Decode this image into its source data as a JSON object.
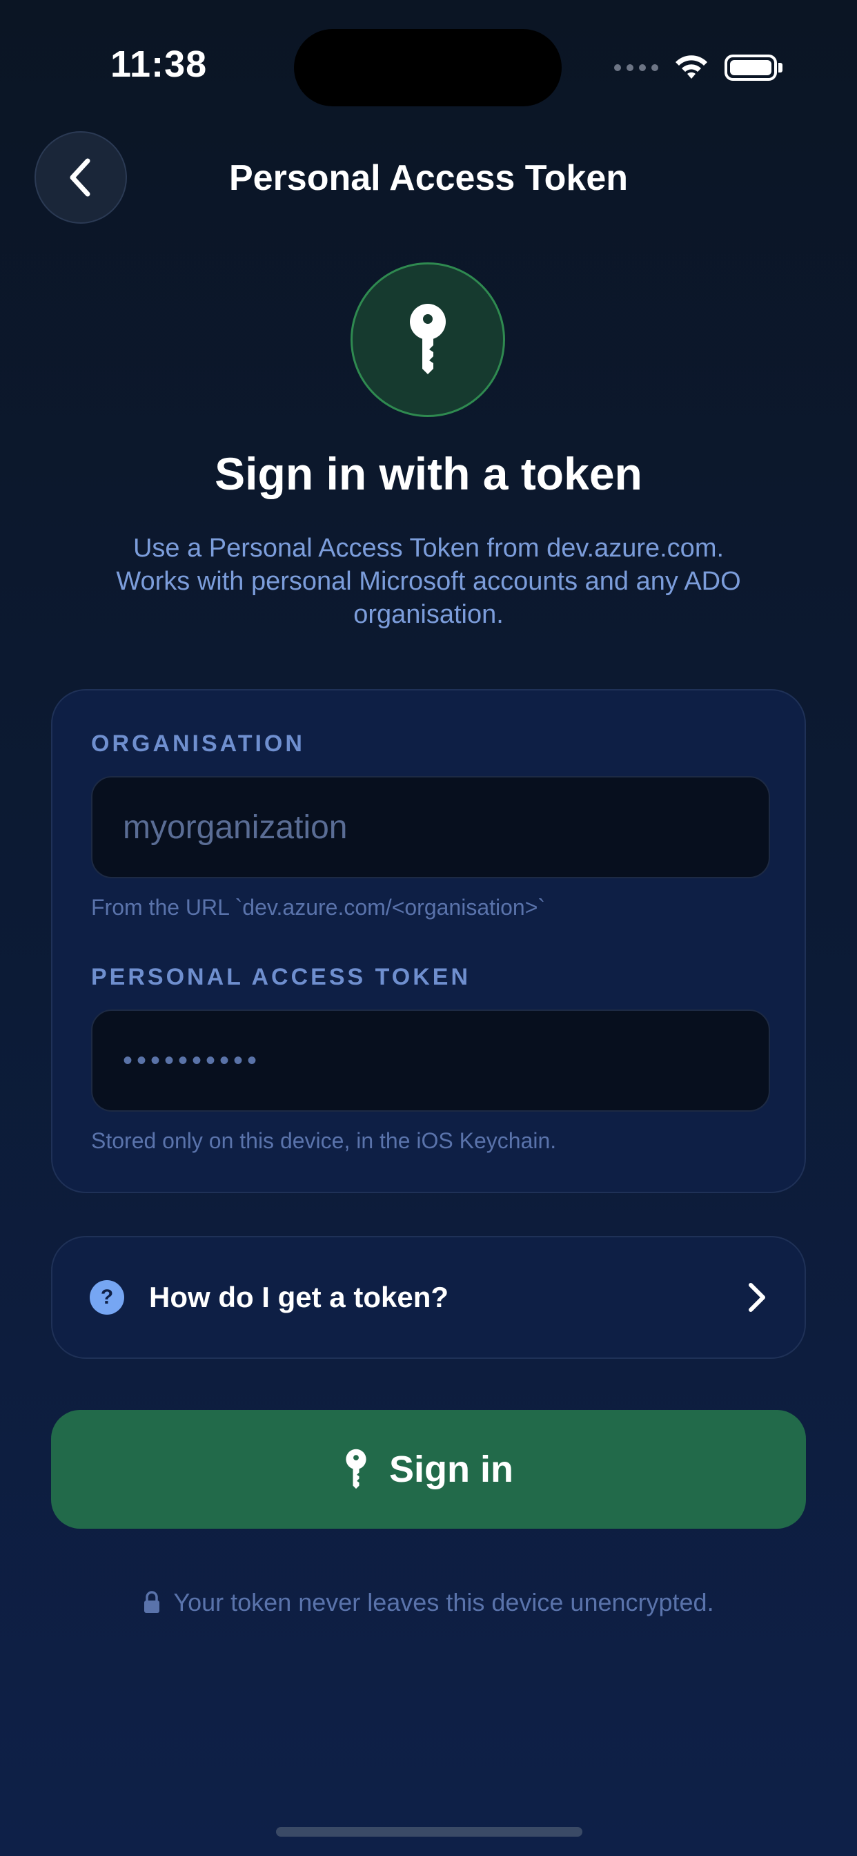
{
  "status_bar": {
    "time": "11:38"
  },
  "nav": {
    "title": "Personal Access Token",
    "back_icon": "chevron-left-icon"
  },
  "hero": {
    "icon": "key-icon",
    "title": "Sign in with a token",
    "subtitle_lines": [
      "Use a Personal Access Token from dev.azure.com.",
      "Works with personal Microsoft accounts and any ADO",
      "organisation."
    ]
  },
  "form": {
    "organisation": {
      "label": "ORGANISATION",
      "value": "",
      "placeholder": "myorganization",
      "help": "From the URL `dev.azure.com/<organisation>`"
    },
    "pat": {
      "label": "PERSONAL ACCESS TOKEN",
      "masked_value": "••••••••••",
      "help": "Stored only on this device, in the iOS Keychain."
    }
  },
  "help_row": {
    "icon": "question-circle-icon",
    "label": "How do I get a token?",
    "chevron": "chevron-right-icon"
  },
  "sign_in_button": {
    "label": "Sign in",
    "icon": "key-icon",
    "color": "#226a4a"
  },
  "footer": {
    "icon": "lock-icon",
    "note": "Your token never leaves this device unencrypted."
  },
  "colors": {
    "accent_green": "#226a4a",
    "badge_border": "#2f8a50",
    "label_blue": "#6f8fcf",
    "help_icon": "#76a6f3"
  }
}
